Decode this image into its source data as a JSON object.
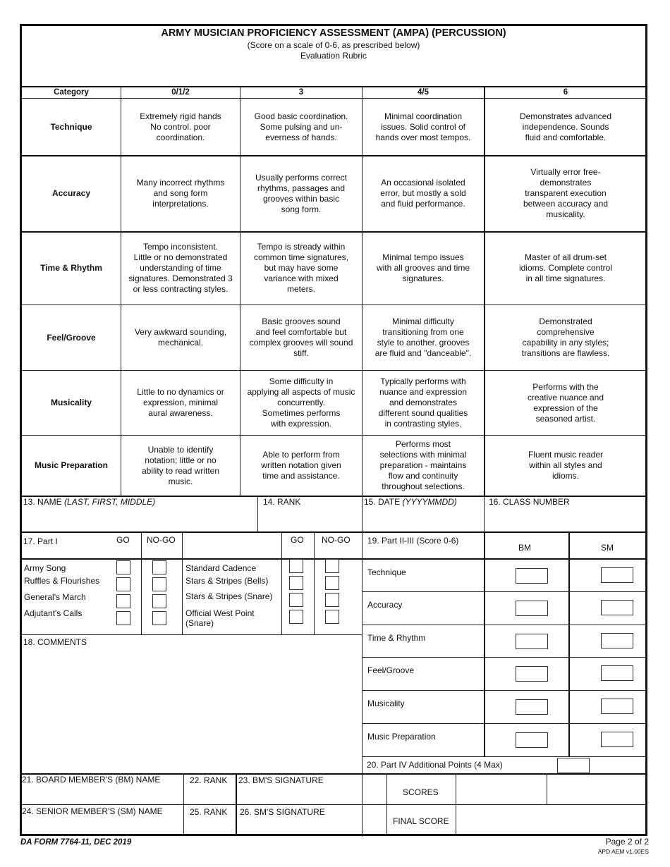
{
  "form": {
    "title": "ARMY MUSICIAN PROFICIENCY ASSESSMENT (AMPA) (PERCUSSION)",
    "subtitle": "(Score on a scale of 0-6, as prescribed below)",
    "rubric_label": "Evaluation Rubric",
    "form_number": "DA FORM 7764-11, DEC 2019",
    "page": "Page 2 of 2",
    "version": "APD AEM v1.00ES"
  },
  "rubric": {
    "headers": [
      "Category",
      "0/1/2",
      "3",
      "4/5",
      "6"
    ],
    "rows": [
      {
        "category": "Technique",
        "cells": [
          "Extremely rigid hands\nNo control.  poor\ncoordination.",
          "Good basic coordination.\nSome pulsing and un-\neverness of hands.",
          "Minimal coordination\nissues.  Solid control of\nhands over most tempos.",
          "Demonstrates advanced\nindependence.  Sounds\nfluid and comfortable."
        ]
      },
      {
        "category": "Accuracy",
        "cells": [
          "Many incorrect rhythms\nand song form\ninterpretations.",
          "Usually performs correct\nrhythms, passages and\ngrooves within basic\nsong form.",
          "An occasional isolated\nerror, but mostly a sold\nand fluid performance.",
          "Virtually error free-\ndemonstrates\ntransparent execution\nbetween accuracy and\nmusicality."
        ]
      },
      {
        "category": "Time & Rhythm",
        "cells": [
          "Tempo inconsistent.\nLittle or no demonstrated\nunderstanding of time\nsignatures.  Demonstrated 3\nor less contracting styles.",
          "Tempo is stready within\ncommon time signatures,\nbut may have some\nvariance with mixed\nmeters.",
          "Minimal tempo issues\nwith all grooves and time\nsignatures.",
          "Master of all drum-set\nidioms.  Complete control\nin all time signatures."
        ]
      },
      {
        "category": "Feel/Groove",
        "cells": [
          "Very awkward sounding,\nmechanical.",
          "Basic grooves sound\nand feel comfortable but\ncomplex grooves will sound\nstiff.",
          "Minimal difficulty\ntransitioning from one\nstyle to another.  grooves\nare fluid and \"danceable\".",
          "Demonstrated\ncomprehensive\ncapability in any styles;\ntransitions are flawless."
        ]
      },
      {
        "category": "Musicality",
        "cells": [
          "Little to no dynamics or\nexpression, minimal\naural awareness.",
          "Some difficulty in\napplying all aspects of music\nconcurrently.\nSometimes performs\nwith expression.",
          "Typically performs with\nnuance and expression\nand demonstrates\ndifferent sound qualities\nin contrasting styles.",
          "Performs with the\ncreative nuance and\nexpression of the\nseasoned artist."
        ]
      },
      {
        "category": "Music Preparation",
        "cells": [
          "Unable to identify\nnotation; little or no\nability to read written\nmusic.",
          "Able to perform from\nwritten notation given\ntime and assistance.",
          "Performs most\nselections with minimal\npreparation - maintains\nflow and continuity\nthroughout selections.",
          "Fluent music reader\nwithin all styles and\nidioms."
        ]
      }
    ]
  },
  "fields": {
    "name_label": "13.  NAME ",
    "name_hint": "(LAST, FIRST, MIDDLE)",
    "name_value": "",
    "rank_label": "14. RANK",
    "rank_value": "",
    "date_label": "15.  DATE ",
    "date_hint": "(YYYYMMDD)",
    "date_value": "",
    "class_label": "16. CLASS NUMBER",
    "class_value": ""
  },
  "part1": {
    "label": "17.  Part I",
    "go_label": "GO",
    "nogo_label": "NO-GO",
    "left_items": [
      {
        "label": "Army Song",
        "go": false,
        "nogo": false
      },
      {
        "label": "Ruffles & Flourishes",
        "go": false,
        "nogo": false
      },
      {
        "label": "General's March",
        "go": false,
        "nogo": false
      },
      {
        "label": "Adjutant's Calls",
        "go": false,
        "nogo": false
      }
    ],
    "right_items": [
      {
        "label": "Standard Cadence",
        "go": false,
        "nogo": false
      },
      {
        "label": "Stars & Stripes (Bells)",
        "go": false,
        "nogo": false
      },
      {
        "label": "Stars & Stripes (Snare)",
        "go": false,
        "nogo": false
      },
      {
        "label": "Official West Point\n(Snare)",
        "go": false,
        "nogo": false
      }
    ]
  },
  "comments": {
    "label": "18.  COMMENTS",
    "value": ""
  },
  "part2": {
    "label": "19.  Part II-III (Score 0-6)",
    "bm_label": "BM",
    "sm_label": "SM",
    "rows": [
      {
        "label": "Technique",
        "bm": "",
        "sm": ""
      },
      {
        "label": "Accuracy",
        "bm": "",
        "sm": ""
      },
      {
        "label": "Time & Rhythm",
        "bm": "",
        "sm": ""
      },
      {
        "label": "Feel/Groove",
        "bm": "",
        "sm": ""
      },
      {
        "label": "Musicality",
        "bm": "",
        "sm": ""
      },
      {
        "label": "Music Preparation",
        "bm": "",
        "sm": ""
      }
    ]
  },
  "part4": {
    "label": "20.  Part IV Additional Points (4 Max)",
    "value": ""
  },
  "signatures": {
    "bm_name_label": "21.  BOARD MEMBER'S (BM) NAME",
    "bm_rank_label": "22. RANK",
    "bm_sig_label": "23. BM'S SIGNATURE",
    "sm_name_label": "24.  SENIOR MEMBER'S (SM) NAME",
    "sm_rank_label": "25. RANK",
    "sm_sig_label": "26.  SM'S SIGNATURE",
    "scores_label": "SCORES",
    "final_score_label": "FINAL SCORE",
    "bm_score": "",
    "sm_score": "",
    "final_score": ""
  }
}
